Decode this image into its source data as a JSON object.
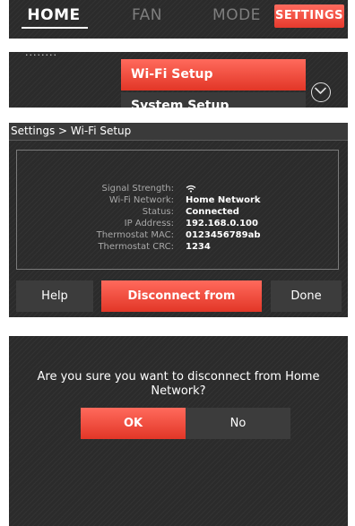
{
  "nav": {
    "home": "HOME",
    "fan": "FAN",
    "mode": "MODE",
    "settings": "SETTINGS"
  },
  "menu": {
    "clipped_text": "........",
    "wifi_setup": "Wi-Fi Setup",
    "system_setup": "System Setup",
    "chevron_icon": "chevron-down-icon"
  },
  "wifi_screen": {
    "title": "Settings > Wi-Fi Setup",
    "rows": [
      {
        "label": "Signal Strength:",
        "value": "",
        "icon": "wifi-signal-icon"
      },
      {
        "label": "Wi-Fi Network:",
        "value": "Home Network"
      },
      {
        "label": "Status:",
        "value": "Connected"
      },
      {
        "label": "IP Address:",
        "value": "192.168.0.100"
      },
      {
        "label": "Thermostat MAC:",
        "value": "0123456789ab"
      },
      {
        "label": "Thermostat CRC:",
        "value": "1234"
      }
    ],
    "help": "Help",
    "disconnect": "Disconnect from Network",
    "done": "Done"
  },
  "dialog": {
    "message": "Are you sure you want to disconnect from Home Network?",
    "ok": "OK",
    "no": "No"
  },
  "colors": {
    "accent": "#e84a3c",
    "background": "#2b2b2b",
    "inactive_text": "#7e7e7e"
  }
}
